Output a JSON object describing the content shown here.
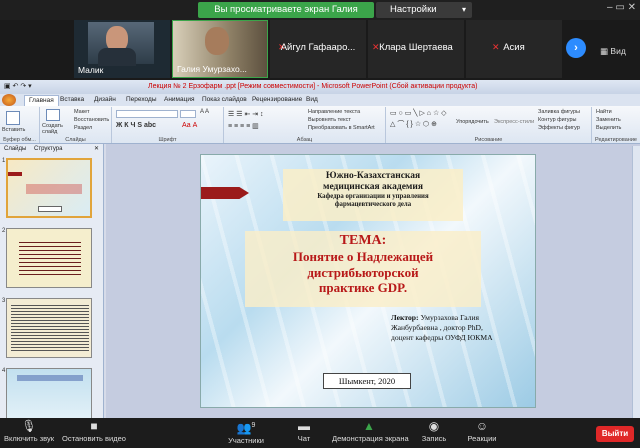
{
  "top_bar": {
    "share_banner": "Вы просматриваете экран Галия Умурзакова",
    "view_options": "Настройки просмотра",
    "window_controls": "– ▭ ✕"
  },
  "participants": [
    {
      "name": "Малик"
    },
    {
      "name": "Галия Умурзахо..."
    },
    {
      "name": "Айгул Гафааро..."
    },
    {
      "name": "Клара Шертаева"
    },
    {
      "name": "Асия"
    }
  ],
  "view_button": "Вид",
  "next_arrow": "›",
  "ppt": {
    "window_title": "Лекция № 2 Ерзофарм .ppt [Режим совместимости] - Microsoft PowerPoint (Сбой активации продукта)",
    "tabs": [
      "Главная",
      "Вставка",
      "Дизайн",
      "Переходы",
      "Анимация",
      "Показ слайдов",
      "Рецензирование",
      "Вид"
    ],
    "ribbon": {
      "paste": "Вставить",
      "create_slide": "Создать слайд",
      "layout": "Макет",
      "restore": "Восстановить",
      "section": "Раздел",
      "group_clipboard": "Буфер обм...",
      "group_slides": "Слайды",
      "group_font": "Шрифт",
      "group_paragraph": "Абзац",
      "group_drawing": "Рисование",
      "group_edit": "Редактирование",
      "text_direction": "Направление текста",
      "align_text": "Выровнять текст",
      "smartart": "Преобразовать в SmartArt",
      "arrange": "Упорядочить",
      "express_styles": "Экспресс-стили",
      "fill": "Заливка фигуры",
      "outline": "Контур фигуры",
      "effects": "Эффекты фигур",
      "find": "Найти",
      "replace": "Заменить",
      "select": "Выделить"
    },
    "pane_tabs": {
      "slides": "Слайды",
      "outline": "Структура"
    },
    "thumb_numbers": [
      "1",
      "2",
      "3",
      "4"
    ],
    "slide": {
      "institution_1": "Южно-Казахстанская",
      "institution_2": "медицинская академия",
      "department": "Кафедра организации и управления фармацевтического дела",
      "topic_label": "ТЕМА:",
      "topic_line1": "Понятие о Надлежащей",
      "topic_line2": "дистрибьюторской",
      "topic_line3": "практике",
      "topic_gdp": "GDP.",
      "lecturer_label": "Лектор:",
      "lecturer_name": "Умурзахова Галия",
      "lecturer_line2": "Жанбурбаевна , доктор PhD,",
      "lecturer_line3": "доцент кафедры ОУФД ЮКМА",
      "city": "Шымкент, 2020"
    }
  },
  "toolbar": {
    "audio": "Включить звук",
    "video": "Остановить видео",
    "participants": "Участники",
    "participants_count": "9",
    "chat": "Чат",
    "share": "Демонстрация экрана",
    "record": "Запись",
    "reactions": "Реакции",
    "end": "Выйти"
  },
  "colors": {
    "share_green": "#3ba54a",
    "zoom_blue": "#2d8cff",
    "end_red": "#e02828",
    "slide_red": "#b81919"
  }
}
